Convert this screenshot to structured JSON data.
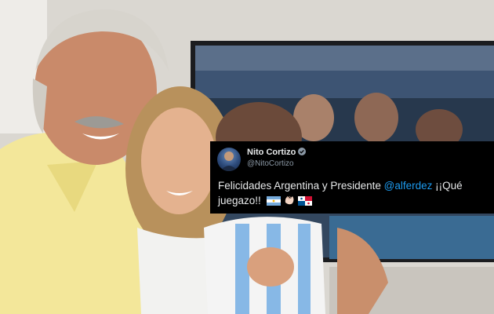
{
  "tweet": {
    "display_name": "Nito Cortizo",
    "handle": "@NitoCortizo",
    "text_prefix": "Felicidades Argentina y Presidente ",
    "mention": "@alferdez",
    "text_suffix": " ¡¡Qué juegazo!!",
    "emojis": [
      "argentina-flag-icon",
      "clapping-hands-icon",
      "panama-flag-icon"
    ],
    "verified": true
  },
  "colors": {
    "card_background": "#000000",
    "name_text": "#e7e9ea",
    "handle_text": "#8b98a5",
    "mention_link": "#1d9bf0",
    "verified_badge": "#8b98a5"
  }
}
